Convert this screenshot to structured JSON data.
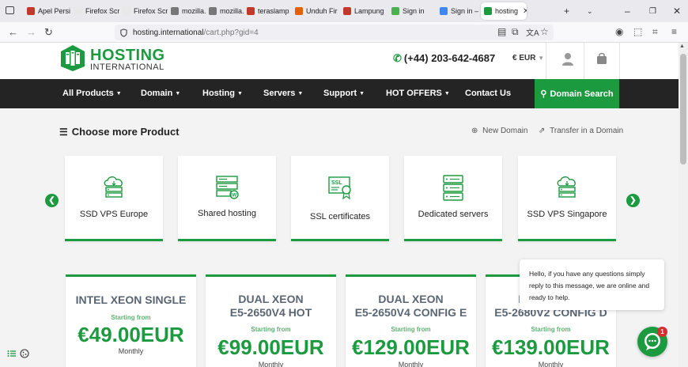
{
  "browser": {
    "tabs": [
      {
        "label": "Apel Persi",
        "color": "#c0392b"
      },
      {
        "label": "Firefox Screen",
        "color": "#e8e8e8"
      },
      {
        "label": "Firefox Screen",
        "color": "#e8e8e8"
      },
      {
        "label": "mozilla.co",
        "color": "#777777"
      },
      {
        "label": "mozilla.co",
        "color": "#777777"
      },
      {
        "label": "teraslamp",
        "color": "#c0392b"
      },
      {
        "label": "Unduh Fir",
        "color": "#e66000"
      },
      {
        "label": "Lampung",
        "color": "#c0392b"
      },
      {
        "label": "Sign in",
        "color": "#4caf50"
      },
      {
        "label": "Sign in – G",
        "color": "#4285f4"
      },
      {
        "label": "hosting",
        "color": "#1c9a3f"
      }
    ],
    "url_host": "hosting.international",
    "url_path": "/cart.php?gid=4"
  },
  "header": {
    "logo_title": "HOSTING",
    "logo_sub": "INTERNATIONAL",
    "phone": "(+44) 203-642-4687",
    "currency": "€ EUR"
  },
  "menu": {
    "items": [
      {
        "label": "All Products",
        "caret": true
      },
      {
        "label": "Domain",
        "caret": true
      },
      {
        "label": "Hosting",
        "caret": true
      },
      {
        "label": "Servers",
        "caret": true
      },
      {
        "label": "Support",
        "caret": true
      },
      {
        "label": "HOT OFFERS",
        "caret": true
      },
      {
        "label": "Contact Us",
        "caret": false
      }
    ],
    "domain_search": "Domain Search"
  },
  "section": {
    "title": "Choose more Product",
    "new_domain": "New Domain",
    "transfer": "Transfer in a Domain"
  },
  "products": [
    {
      "label": "SSD VPS Europe",
      "icon": "cloud-server-icon"
    },
    {
      "label": "Shared hosting",
      "icon": "shared-hosting-icon"
    },
    {
      "label": "SSL certificates",
      "icon": "ssl-certificate-icon"
    },
    {
      "label": "Dedicated servers",
      "icon": "server-rack-icon"
    },
    {
      "label": "SSD VPS Singapore",
      "icon": "cloud-server-icon"
    }
  ],
  "plans": [
    {
      "name1": "INTEL XEON SINGLE",
      "name2": "",
      "starting": "Starting from",
      "price": "€49.00EUR",
      "period": "Monthly"
    },
    {
      "name1": "DUAL XEON",
      "name2": "E5-2650V4 HOT",
      "starting": "Starting from",
      "price": "€99.00EUR",
      "period": "Monthly"
    },
    {
      "name1": "DUAL XEON",
      "name2": "E5-2650V4 CONFIG E",
      "starting": "Starting from",
      "price": "€129.00EUR",
      "period": "Monthly"
    },
    {
      "name1": "DUAL XEON",
      "name2": "E5-2680V2 CONFIG D",
      "starting": "Starting from",
      "price": "€139.00EUR",
      "period": "Monthly"
    }
  ],
  "chat": {
    "message": "Hello, if you have any questions simply reply to this message, we are online and ready to help.",
    "badge": "1"
  },
  "colors": {
    "brand": "#1c9a3f",
    "dark": "#242424"
  }
}
